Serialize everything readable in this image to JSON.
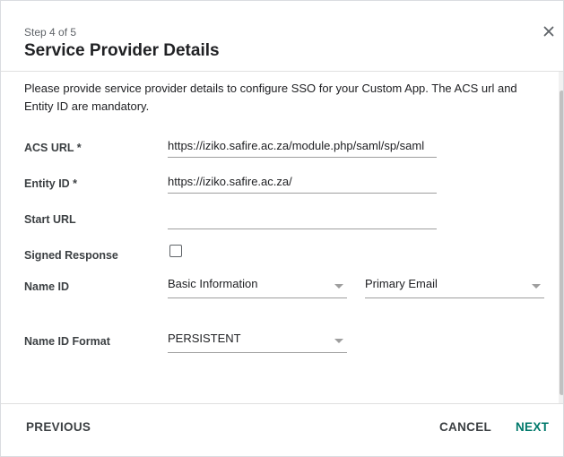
{
  "dialog": {
    "step": "Step 4 of 5",
    "title": "Service Provider Details",
    "description": "Please provide service provider details to configure SSO for your Custom App. The ACS url and Entity ID are mandatory."
  },
  "form": {
    "acs_url": {
      "label": "ACS URL *",
      "value": "https://iziko.safire.ac.za/module.php/saml/sp/saml"
    },
    "entity_id": {
      "label": "Entity ID *",
      "value": "https://iziko.safire.ac.za/"
    },
    "start_url": {
      "label": "Start URL",
      "value": ""
    },
    "signed_response": {
      "label": "Signed Response",
      "checked": false
    },
    "name_id": {
      "label": "Name ID",
      "category": "Basic Information",
      "field": "Primary Email"
    },
    "name_id_format": {
      "label": "Name ID Format",
      "value": "PERSISTENT"
    }
  },
  "footer": {
    "previous_label": "PREVIOUS",
    "cancel_label": "CANCEL",
    "next_label": "NEXT"
  },
  "colors": {
    "accent": "#00796b",
    "text": "#202124",
    "muted": "#5f6368"
  }
}
